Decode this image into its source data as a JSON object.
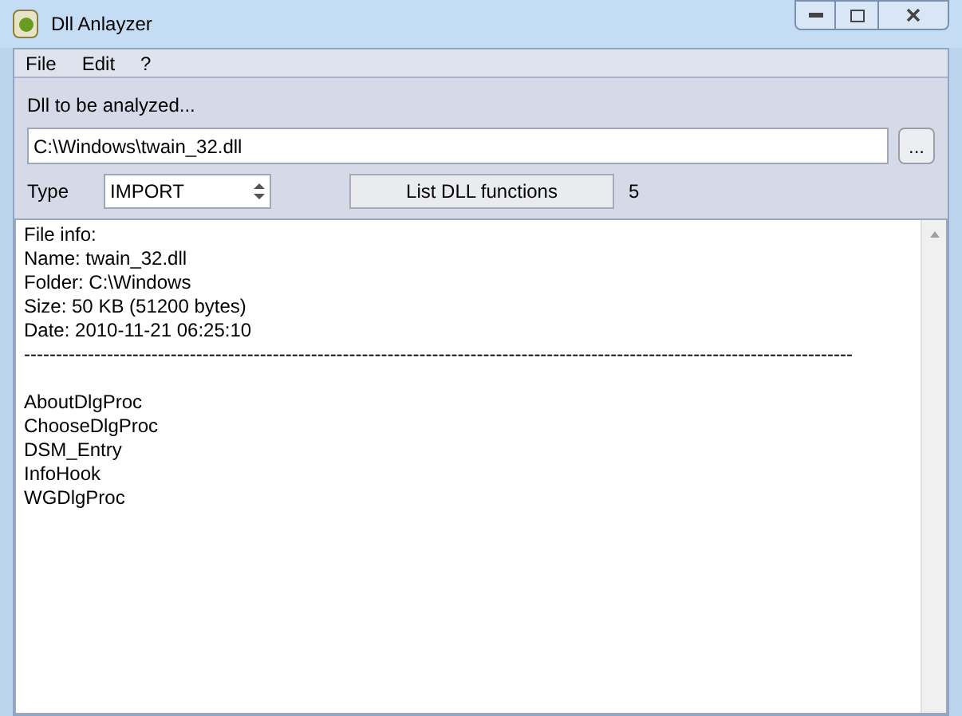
{
  "window": {
    "title": "Dll Anlayzer"
  },
  "menu": [
    "File",
    "Edit",
    "?"
  ],
  "file_field": {
    "label": "Dll to be analyzed...",
    "value": "C:\\Windows\\twain_32.dll",
    "browse": "..."
  },
  "type_select": {
    "label": "Type",
    "value": "IMPORT"
  },
  "list_button": "List DLL functions",
  "function_count": "5",
  "file_info": [
    "File info:",
    "Name: twain_32.dll",
    "Folder: C:\\Windows",
    "Size: 50 KB (51200 bytes)",
    "Date: 2010-11-21 06:25:10"
  ],
  "separator": "----------------------------------------------------------------------------------------------------------------------------------",
  "functions": [
    "AboutDlgProc",
    "ChooseDlgProc",
    "DSM_Entry",
    "InfoHook",
    "WGDlgProc"
  ]
}
